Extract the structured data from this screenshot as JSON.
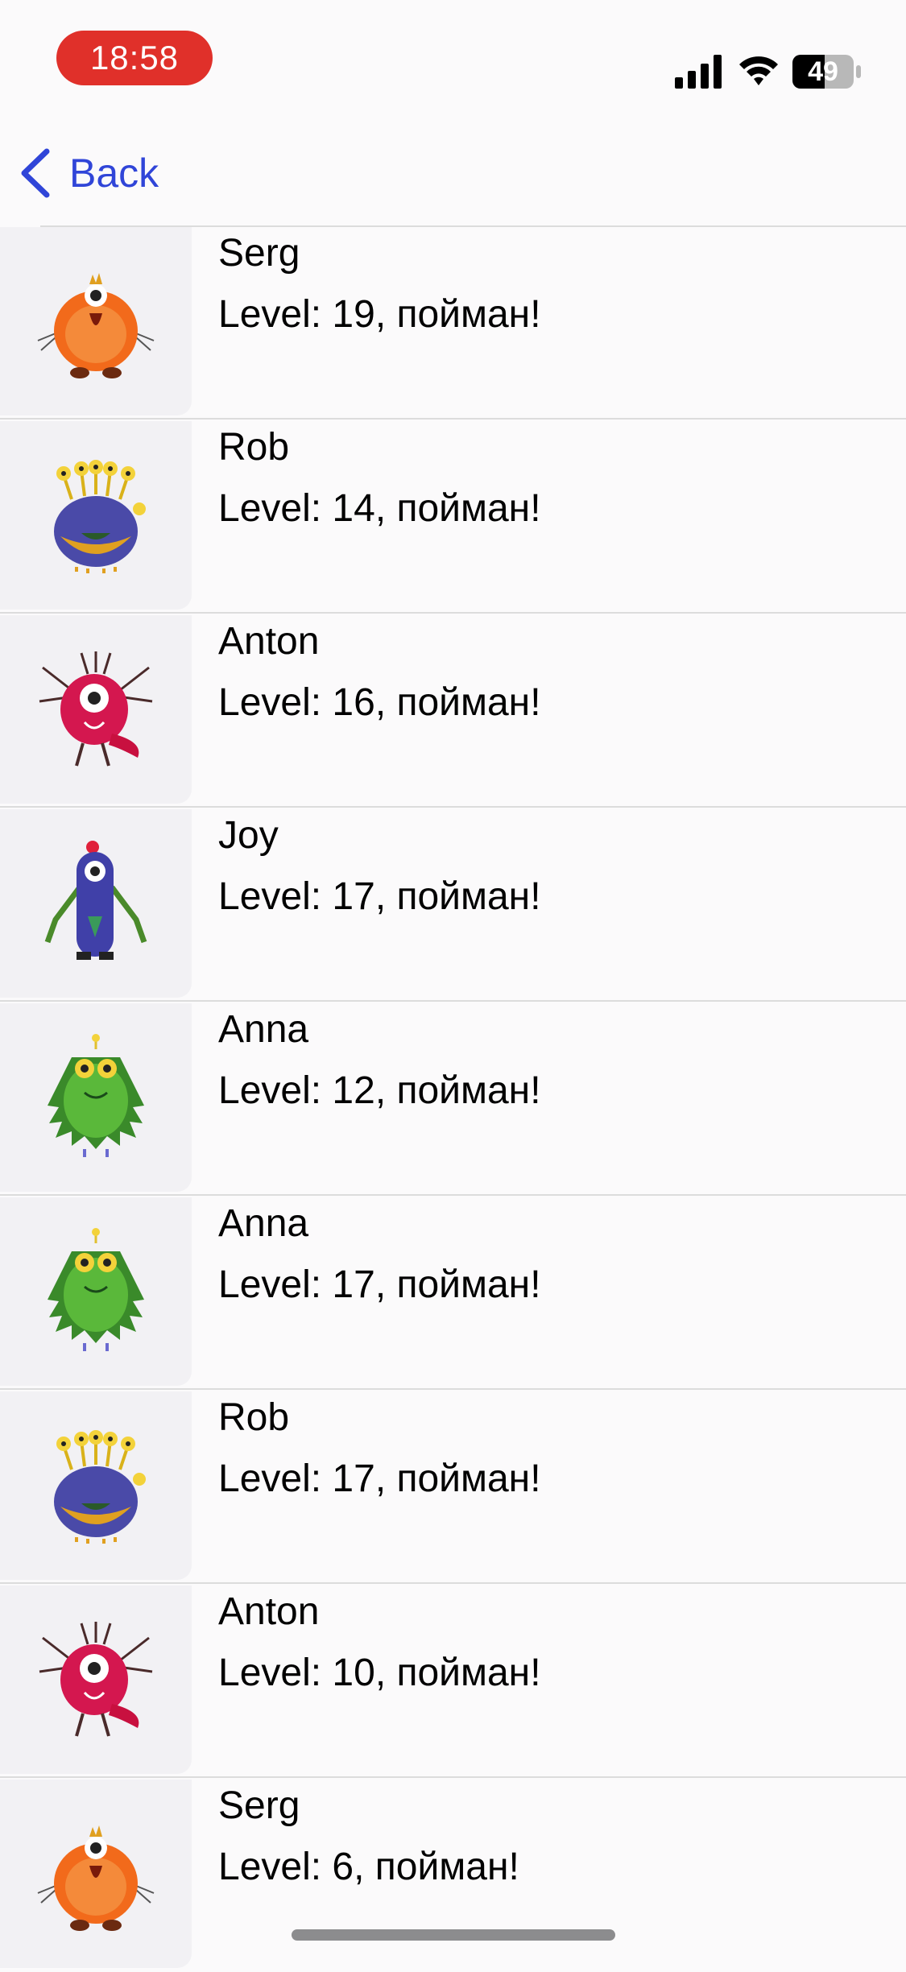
{
  "status_bar": {
    "time": "18:58",
    "battery_level": "49"
  },
  "nav": {
    "back_label": "Back",
    "icon": "chevron-left-icon"
  },
  "colors": {
    "accent": "#3045d8",
    "time_pill": "#e0302a"
  },
  "list": {
    "items": [
      {
        "name": "Serg",
        "status": "Level: 19, пойман!",
        "monster": "orange-monster-icon"
      },
      {
        "name": "Rob",
        "status": "Level: 14, пойман!",
        "monster": "purple-monster-icon"
      },
      {
        "name": "Anton",
        "status": "Level: 16, пойман!",
        "monster": "red-monster-icon"
      },
      {
        "name": "Joy",
        "status": "Level: 17, пойман!",
        "monster": "blue-monster-icon"
      },
      {
        "name": "Anna",
        "status": "Level: 12, пойман!",
        "monster": "green-monster-icon"
      },
      {
        "name": "Anna",
        "status": "Level: 17, пойман!",
        "monster": "green-monster-icon"
      },
      {
        "name": "Rob",
        "status": "Level: 17, пойман!",
        "monster": "purple-monster-icon"
      },
      {
        "name": "Anton",
        "status": "Level: 10, пойман!",
        "monster": "red-monster-icon"
      },
      {
        "name": "Serg",
        "status": "Level: 6, пойман!",
        "monster": "orange-monster-icon"
      }
    ]
  }
}
